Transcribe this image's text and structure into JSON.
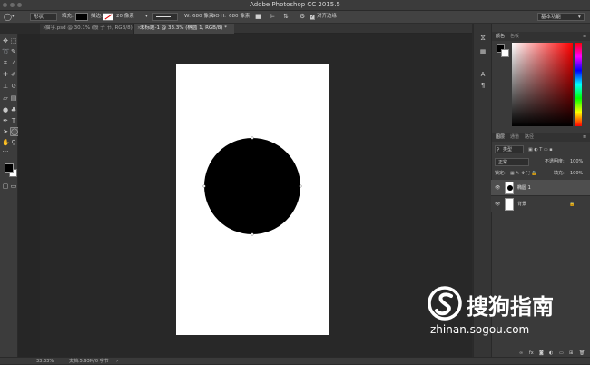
{
  "app": {
    "title": "Adobe Photoshop CC 2015.5"
  },
  "options_bar": {
    "tool_mode": "形状",
    "fill_label": "填充:",
    "stroke_label": "描边:",
    "stroke_size": "20 像素",
    "w_label": "W:",
    "w_value": "680 像素",
    "link_glyph": "GO",
    "h_label": "H:",
    "h_value": "680 像素",
    "align_edges_label": "对齐边缘",
    "workspace": "基本功能"
  },
  "tabs": [
    {
      "label": "猫乎.psd @ 30.1% (骰 子 节, RGB/8)",
      "active": false
    },
    {
      "label": "未标题-1 @ 33.3% (椭圆 1, RGB/8) *",
      "active": true
    }
  ],
  "panels": {
    "color_tabs": [
      "颜色",
      "色板"
    ],
    "layers_tabs": [
      "图层",
      "通道",
      "路径"
    ],
    "filter_kind": "类型",
    "blend_mode": "正常",
    "opacity_label": "不透明度:",
    "opacity_value": "100%",
    "lock_label": "锁定:",
    "fill_label": "填充:",
    "fill_value": "100%"
  },
  "layers": [
    {
      "name": "椭圆 1",
      "selected": true
    },
    {
      "name": "背景",
      "selected": false
    }
  ],
  "status": {
    "zoom": "33.33%",
    "doc_info": "文档:5.93M/0 字节"
  },
  "watermark": {
    "brand": "搜狗指南",
    "url": "zhinan.sogou.com"
  },
  "colors": {
    "foreground": "#000000",
    "background": "#ffffff",
    "accent": "#3f6a9e"
  }
}
